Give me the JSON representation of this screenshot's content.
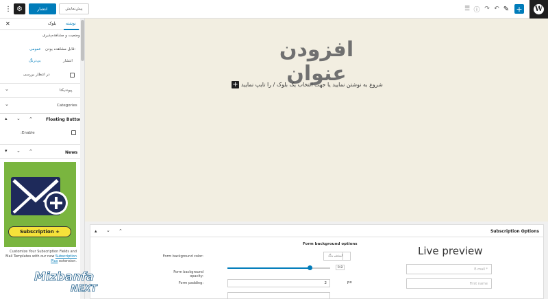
{
  "toolbar": {
    "more_icon": "vertical-ellipsis-icon",
    "settings_icon": "gear-icon",
    "publish_label": "انتشار",
    "preview_label": "پیش‌نمایش",
    "list_view_icon": "list-view-icon",
    "info_icon": "info-icon",
    "redo_icon": "redo-icon",
    "undo_icon": "undo-icon",
    "edit_icon": "pencil-icon",
    "add_block_icon": "plus-icon",
    "logo_icon": "wordpress-logo-icon",
    "accent_color": "#007cba"
  },
  "sidebar": {
    "tabs": {
      "post": "نوشته",
      "block": "بلوک"
    },
    "status_section": {
      "heading": "وضعیت و مشاهده‌پذیری",
      "visibility_label": "قابل مشاهده بودن:",
      "visibility_value": "عمومی",
      "publish_label": "انتشار",
      "publish_value": "بی‌درنگ",
      "pending_label": "در انتظار بررسی"
    },
    "panels": {
      "permalink": "پیوندیکتا",
      "categories": "Categories",
      "floating_button": "Floating Button",
      "enable_label": ":Enable",
      "news": "News"
    },
    "subscription": {
      "banner": "Subscription +",
      "desc_prefix": "Customize Your Subscription Fields and Mail Templates with our new",
      "desc_link": "Subscription Plus",
      "desc_suffix": "extension."
    }
  },
  "editor": {
    "title_placeholder": "افزودن عنوان",
    "paragraph_placeholder": "شروع به نوشتن نمایید یا جهت انتخاب یک بلوک / را تایپ نمایید"
  },
  "metabox": {
    "title": "Subscription Options",
    "options_heading": "Form background options",
    "bg_color_label": "Form background color:",
    "color_button": "گزینش رنگ",
    "opacity_label": "Form background opacity:",
    "opacity_value": "0.8",
    "opacity_level": 0.8,
    "padding_label": "Form padding:",
    "padding_value": "2",
    "padding_unit": "px",
    "live_preview": "Live preview",
    "email_placeholder": "E-mail *",
    "first_name_placeholder": "First name"
  },
  "watermark": {
    "line1": "Mizbanfa",
    "line2": "NEXT"
  }
}
